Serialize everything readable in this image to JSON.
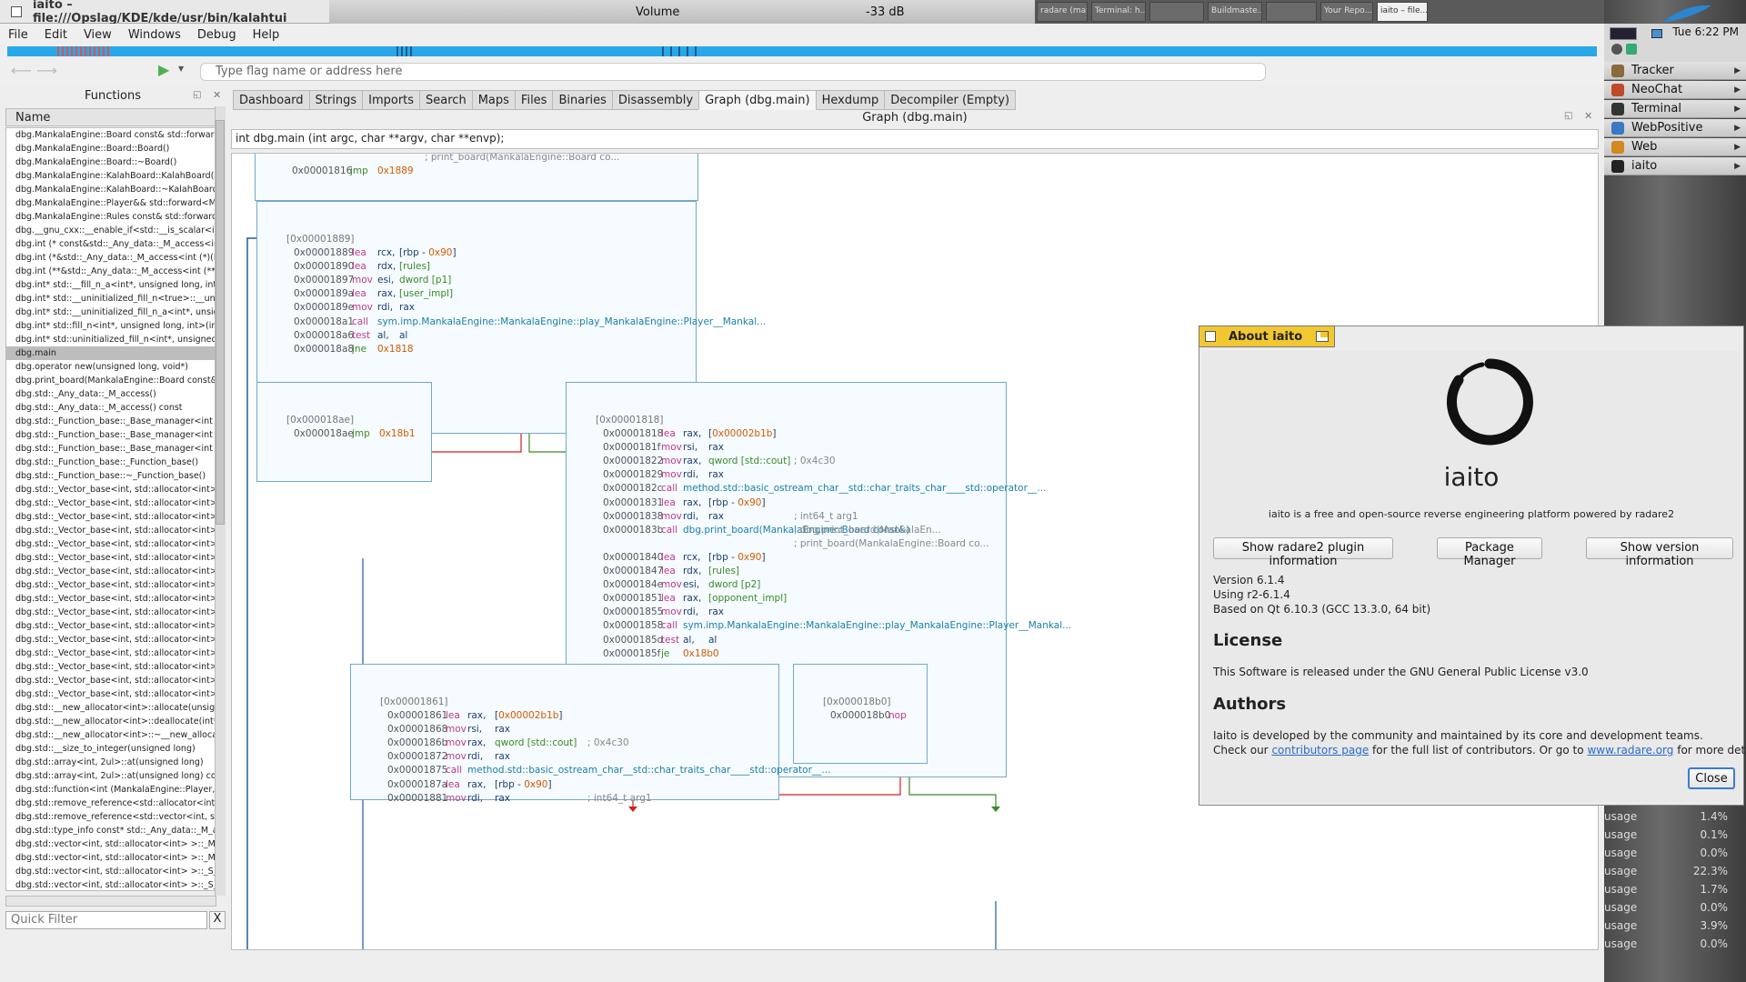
{
  "taskbar": {
    "window_title": "iaito – file:///Opslag/KDE/kde/usr/bin/kalahtui",
    "volume_label": "Volume",
    "volume_value": "-33 dB",
    "tasks": [
      "radare (mat...",
      "Terminal: h...",
      "",
      "Buildmaste...",
      "",
      "Your Repo...",
      "iaito – file..."
    ]
  },
  "clock": "Tue 6:22 PM",
  "launchers": [
    {
      "label": "Tracker",
      "color": "#8a6a3a"
    },
    {
      "label": "NeoChat",
      "color": "#c04a2a"
    },
    {
      "label": "Terminal",
      "color": "#333333"
    },
    {
      "label": "WebPositive",
      "color": "#3a78c0"
    },
    {
      "label": "Web",
      "color": "#d08a20"
    },
    {
      "label": "iaito",
      "color": "#222222"
    }
  ],
  "usage_rows": [
    {
      "label": "usage",
      "value": "1.4%"
    },
    {
      "label": "usage",
      "value": "0.1%"
    },
    {
      "label": "usage",
      "value": "0.0%"
    },
    {
      "label": "usage",
      "value": "22.3%"
    },
    {
      "label": "usage",
      "value": "1.7%"
    },
    {
      "label": "usage",
      "value": "0.0%"
    },
    {
      "label": "usage",
      "value": "3.9%"
    },
    {
      "label": "usage",
      "value": "0.0%"
    }
  ],
  "menu": [
    "File",
    "Edit",
    "View",
    "Windows",
    "Debug",
    "Help"
  ],
  "search_placeholder": "Type flag name or address here",
  "functions_panel": {
    "title": "Functions",
    "column": "Name",
    "filter_placeholder": "Quick Filter",
    "filter_clear": "X",
    "items": [
      "dbg.MankalaEngine::Board const& std::forward<Mankal",
      "dbg.MankalaEngine::Board::Board()",
      "dbg.MankalaEngine::Board::~Board()",
      "dbg.MankalaEngine::KalahBoard::KalahBoard()",
      "dbg.MankalaEngine::KalahBoard::~KalahBoard()",
      "dbg.MankalaEngine::Player&& std::forward<MankalaEn",
      "dbg.MankalaEngine::Rules const& std::forward<Mankal",
      "dbg.__gnu_cxx::__enable_if<std::__is_scalar<int>::__valu",
      "dbg.int (* const&std::_Any_data::_M_access<int (*)(Mank",
      "dbg.int (*&std::_Any_data::_M_access<int (*)(MankalaEn",
      "dbg.int (**&std::_Any_data::_M_access<int (**)(Mankala",
      "dbg.int* std::__fill_n_a<int*, unsigned long, int>(int*, uns",
      "dbg.int* std::__uninitialized_fill_n<true>::__uninit_fill_n<",
      "dbg.int* std::__uninitialized_fill_n_a<int*, unsigned long,",
      "dbg.int* std::fill_n<int*, unsigned long, int>(int*, unsigne",
      "dbg.int* std::uninitialized_fill_n<int*, unsigned long, int>(",
      "dbg.main",
      "dbg.operator new(unsigned long, void*)",
      "dbg.print_board(MankalaEngine::Board const&)",
      "dbg.std::_Any_data::_M_access()",
      "dbg.std::_Any_data::_M_access() const",
      "dbg.std::_Function_base::_Base_manager<int (*)(Manka",
      "dbg.std::_Function_base::_Base_manager<int (*)(Manka",
      "dbg.std::_Function_base::_Base_manager<int (*)(Manka",
      "dbg.std::_Function_base::_Function_base()",
      "dbg.std::_Function_base::~_Function_base()",
      "dbg.std::_Vector_base<int, std::allocator<int> >::_M_allo",
      "dbg.std::_Vector_base<int, std::allocator<int> >::_M_crea",
      "dbg.std::_Vector_base<int, std::allocator<int> >::_M_deal",
      "dbg.std::_Vector_base<int, std::allocator<int> >::_M_get_",
      "dbg.std::_Vector_base<int, std::allocator<int> >::_M_get_",
      "dbg.std::_Vector_base<int, std::allocator<int> >::_Vector_",
      "dbg.std::_Vector_base<int, std::allocator<int> >::_Vector_",
      "dbg.std::_Vector_base<int, std::allocator<int> >::_Vector_",
      "dbg.std::_Vector_base<int, std::allocator<int> >::_Vector_",
      "dbg.std::_Vector_base<int, std::allocator<int> >::_Vector_",
      "dbg.std::_Vector_base<int, std::allocator<int> >::_Vector_",
      "dbg.std::_Vector_base<int, std::allocator<int> >::_Vector_",
      "dbg.std::_Vector_base<int, std::allocator<int> >::_Vector_",
      "dbg.std::_Vector_base<int, std::allocator<int> >::_Vector_",
      "dbg.std::_Vector_base<int, std::allocator<int> >::get_allo",
      "dbg.std::_Vector_base<int, std::allocator<int> >::~_Vecto",
      "dbg.std::__new_allocator<int>::allocate(unsigned long, v",
      "dbg.std::__new_allocator<int>::deallocate(int*, unsigned",
      "dbg.std::__new_allocator<int>::~__new_allocator()",
      "dbg.std::__size_to_integer(unsigned long)",
      "dbg.std::array<int, 2ul>::at(unsigned long)",
      "dbg.std::array<int, 2ul>::at(unsigned long) const",
      "dbg.std::function<int (MankalaEngine::Player, MankalaE",
      "dbg.std::remove_reference<std::allocator<int>&>::type&",
      "dbg.std::remove_reference<std::vector<int, std::allocato",
      "dbg.std::type_info const* std::_Any_data::_M_access<st",
      "dbg.std::vector<int, std::allocator<int> >::_M_fill_initialize",
      "dbg.std::vector<int, std::allocator<int> >::_M_move_assi",
      "dbg.std::vector<int, std::allocator<int> >::_S_check_init_l",
      "dbg.std::vector<int, std::allocator<int> >::_S_max_size(st"
    ]
  },
  "tabs": [
    "Dashboard",
    "Strings",
    "Imports",
    "Search",
    "Maps",
    "Files",
    "Binaries",
    "Disassembly",
    "Graph (dbg.main)",
    "Hexdump",
    "Decompiler (Empty)"
  ],
  "graph": {
    "title": "Graph (dbg.main)",
    "signature": "int dbg.main (int argc, char **argv, char **envp);",
    "node_top": {
      "lines": [
        {
          "addr": "",
          "mn": "",
          "op": "",
          "cm": "; print_board(MankalaEngine::Board co..."
        },
        {
          "addr": "0x00001816",
          "mn": "jmp",
          "op": "0x1889"
        }
      ]
    },
    "node_1889": {
      "label": "[0x00001889]",
      "lines": [
        {
          "addr": "0x00001889",
          "mn": "lea",
          "op": "rcx,",
          "arg": "[rbp - 0x90]"
        },
        {
          "addr": "0x00001890",
          "mn": "lea",
          "op": "rdx,",
          "arg": "[rules]"
        },
        {
          "addr": "0x00001897",
          "mn": "mov",
          "op": "esi,",
          "arg": "dword [p1]"
        },
        {
          "addr": "0x0000189a",
          "mn": "lea",
          "op": "rax,",
          "arg": "[user_impl]"
        },
        {
          "addr": "0x0000189e",
          "mn": "mov",
          "op": "rdi,",
          "arg": "rax"
        },
        {
          "addr": "0x000018a1",
          "mn": "call",
          "op": "sym.imp.MankalaEngine::MankalaEngine::play_MankalaEngine::Player__Mankal...",
          "arg": ""
        },
        {
          "addr": "0x000018a6",
          "mn": "test",
          "op": "al,",
          "arg": "al"
        },
        {
          "addr": "0x000018a8",
          "mn": "jne",
          "op": "0x1818",
          "arg": ""
        }
      ]
    },
    "node_18ae": {
      "label": "[0x000018ae]",
      "lines": [
        {
          "addr": "0x000018ae",
          "mn": "jmp",
          "op": "0x18b1",
          "arg": ""
        }
      ]
    },
    "node_1818": {
      "label": "[0x00001818]",
      "lines": [
        {
          "addr": "0x00001818",
          "mn": "lea",
          "op": "rax,",
          "arg": "[0x00002b1b]",
          "cm": ""
        },
        {
          "addr": "0x0000181f",
          "mn": "mov",
          "op": "rsi,",
          "arg": "rax",
          "cm": ""
        },
        {
          "addr": "0x00001822",
          "mn": "mov",
          "op": "rax,",
          "arg": "qword [std::cout]",
          "cm": "; 0x4c30"
        },
        {
          "addr": "0x00001829",
          "mn": "mov",
          "op": "rdi,",
          "arg": "rax",
          "cm": ""
        },
        {
          "addr": "0x0000182c",
          "mn": "call",
          "op": "method.std::basic_ostream_char__std::char_traits_char____std::operator__...",
          "arg": "",
          "cm": ""
        },
        {
          "addr": "0x00001831",
          "mn": "lea",
          "op": "rax,",
          "arg": "[rbp - 0x90]",
          "cm": ""
        },
        {
          "addr": "0x00001838",
          "mn": "mov",
          "op": "rdi,",
          "arg": "rax",
          "cm": "; int64_t arg1"
        },
        {
          "addr": "0x0000183b",
          "mn": "call",
          "op": "dbg.print_board(MankalaEngine::Board const&)",
          "arg": "",
          "cm": "; dbg.print_board(MankalaEn..."
        },
        {
          "addr": "",
          "mn": "",
          "op": "",
          "arg": "",
          "cm": "; print_board(MankalaEngine::Board co..."
        },
        {
          "addr": "0x00001840",
          "mn": "lea",
          "op": "rcx,",
          "arg": "[rbp - 0x90]",
          "cm": ""
        },
        {
          "addr": "0x00001847",
          "mn": "lea",
          "op": "rdx,",
          "arg": "[rules]",
          "cm": ""
        },
        {
          "addr": "0x0000184e",
          "mn": "mov",
          "op": "esi,",
          "arg": "dword [p2]",
          "cm": ""
        },
        {
          "addr": "0x00001851",
          "mn": "lea",
          "op": "rax,",
          "arg": "[opponent_impl]",
          "cm": ""
        },
        {
          "addr": "0x00001855",
          "mn": "mov",
          "op": "rdi,",
          "arg": "rax",
          "cm": ""
        },
        {
          "addr": "0x00001858",
          "mn": "call",
          "op": "sym.imp.MankalaEngine::MankalaEngine::play_MankalaEngine::Player__Mankal...",
          "arg": "",
          "cm": ""
        },
        {
          "addr": "0x0000185d",
          "mn": "test",
          "op": "al,",
          "arg": "al",
          "cm": ""
        },
        {
          "addr": "0x0000185f",
          "mn": "je",
          "op": "0x18b0",
          "arg": "",
          "cm": ""
        }
      ]
    },
    "node_1861": {
      "label": "[0x00001861]",
      "lines": [
        {
          "addr": "0x00001861",
          "mn": "lea",
          "op": "rax,",
          "arg": "[0x00002b1b]",
          "cm": ""
        },
        {
          "addr": "0x00001868",
          "mn": "mov",
          "op": "rsi,",
          "arg": "rax",
          "cm": ""
        },
        {
          "addr": "0x0000186b",
          "mn": "mov",
          "op": "rax,",
          "arg": "qword [std::cout]",
          "cm": "; 0x4c30"
        },
        {
          "addr": "0x00001872",
          "mn": "mov",
          "op": "rdi,",
          "arg": "rax",
          "cm": ""
        },
        {
          "addr": "0x00001875",
          "mn": "call",
          "op": "method.std::basic_ostream_char__std::char_traits_char____std::operator__...",
          "arg": "",
          "cm": ""
        },
        {
          "addr": "0x0000187a",
          "mn": "lea",
          "op": "rax,",
          "arg": "[rbp - 0x90]",
          "cm": ""
        },
        {
          "addr": "0x00001881",
          "mn": "mov",
          "op": "rdi,",
          "arg": "rax",
          "cm": "; int64_t arg1"
        }
      ]
    },
    "node_18b0": {
      "label": "[0x000018b0]",
      "lines": [
        {
          "addr": "0x000018b0",
          "mn": "nop",
          "op": "",
          "arg": ""
        }
      ]
    }
  },
  "about": {
    "title": "About iaito",
    "app_name": "iaito",
    "tagline": "iaito is a free and open-source reverse engineering platform powered by radare2",
    "btn_plugins": "Show radare2 plugin information",
    "btn_packages": "Package Manager",
    "btn_version": "Show version information",
    "version": "Version 6.1.4",
    "using": "Using r2-6.1.4",
    "based_on": "Based on Qt 6.10.3 (GCC 13.3.0, 64 bit)",
    "license_heading": "License",
    "license_text": "This Software is released under the GNU General Public License v3.0",
    "authors_heading": "Authors",
    "authors_text1": "Iaito is developed by the community and maintained by its core and development teams.",
    "authors_text2_a": "Check our",
    "authors_link1": "contributors page",
    "authors_text2_b": "for the full list of contributors. Or go to",
    "authors_link2": "www.radare.org",
    "authors_text2_c": "for more details.",
    "close": "Close"
  },
  "colors": {
    "progress": "#28a8e8",
    "node_border": "#74a8c8",
    "mnemonic": "#c0398a",
    "jump_mnemonic": "#3a8a26",
    "number": "#d45a00",
    "true_edge": "#3a8a26",
    "false_edge": "#d02020",
    "edge": "#1e5c9a",
    "dialog_title": "#f2c832"
  }
}
